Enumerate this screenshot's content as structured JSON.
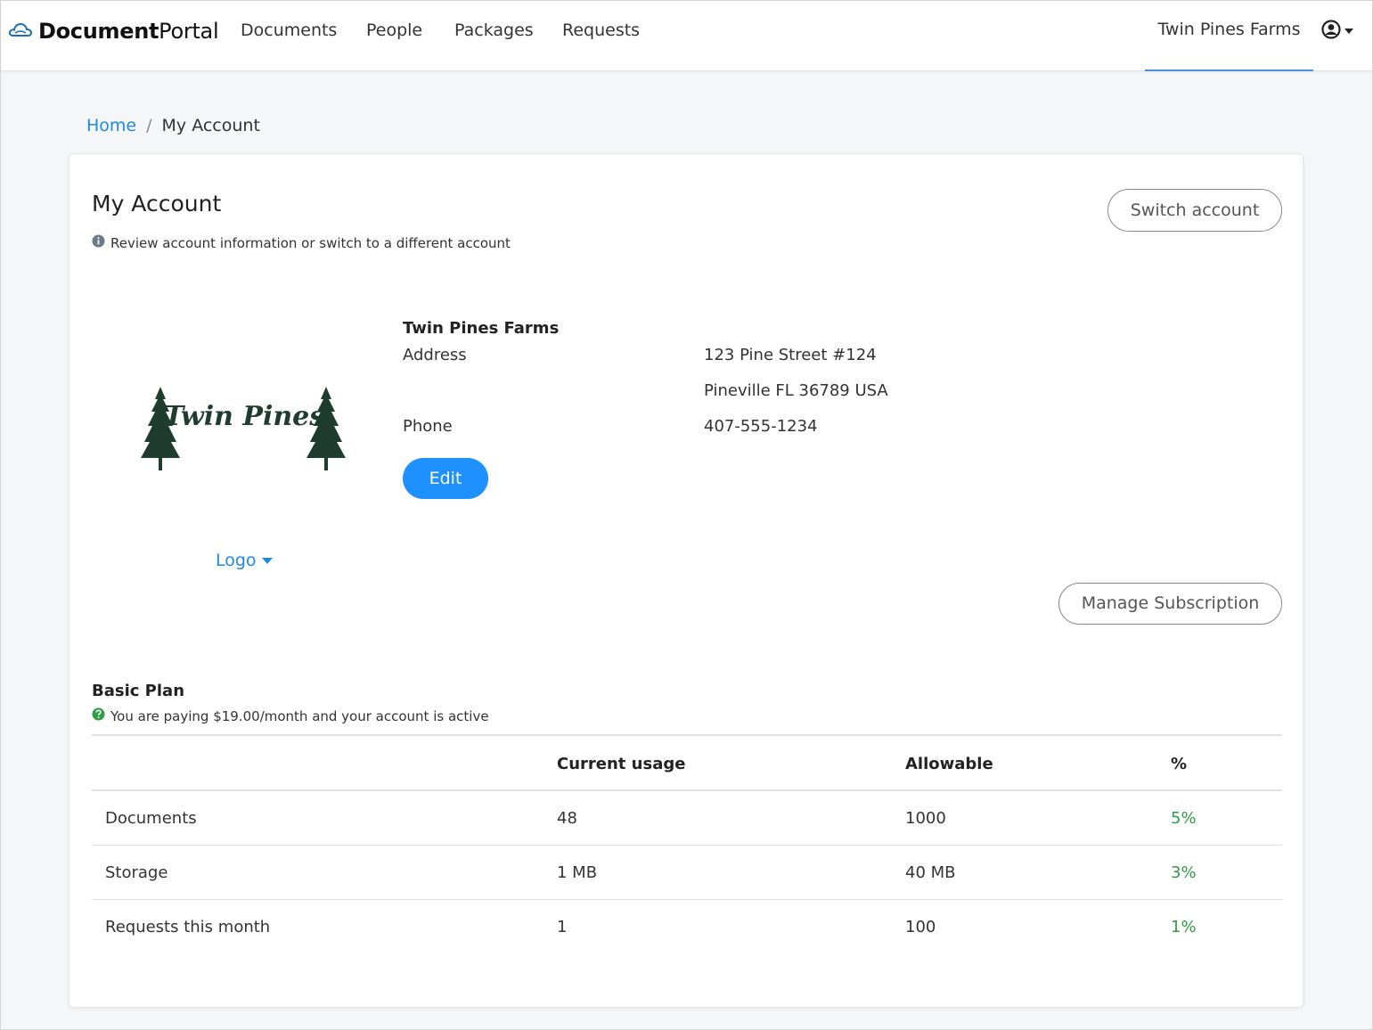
{
  "brand": {
    "bold": "Document",
    "light": "Portal"
  },
  "nav": {
    "items": [
      "Documents",
      "People",
      "Packages",
      "Requests"
    ],
    "account": "Twin Pines Farms"
  },
  "breadcrumb": {
    "home": "Home",
    "separator": "/",
    "current": "My Account"
  },
  "page": {
    "title": "My Account",
    "subtitle": "Review account information or switch to a different account",
    "switch_label": "Switch account",
    "manage_label": "Manage Subscription"
  },
  "logo": {
    "text": "Twin Pines",
    "menu_label": "Logo"
  },
  "company": {
    "name": "Twin Pines Farms",
    "address_label": "Address",
    "address_line1": "123 Pine Street #124",
    "address_line2": "Pineville FL 36789 USA",
    "phone_label": "Phone",
    "phone": "407-555-1234",
    "edit_label": "Edit"
  },
  "plan": {
    "name": "Basic Plan",
    "status": "You are paying $19.00/month and your account is active",
    "headers": [
      "",
      "Current usage",
      "Allowable",
      "%"
    ],
    "rows": [
      {
        "name": "Documents",
        "current": "48",
        "allowable": "1000",
        "percent": "5%"
      },
      {
        "name": "Storage",
        "current": "1 MB",
        "allowable": "40 MB",
        "percent": "3%"
      },
      {
        "name": "Requests this month",
        "current": "1",
        "allowable": "100",
        "percent": "1%"
      }
    ]
  },
  "colors": {
    "primary": "#1e90ff",
    "link": "#1e88e5",
    "success": "#2e9e44"
  },
  "icons": [
    "cloud-icon",
    "user-circle-icon",
    "caret-down-icon",
    "info-icon",
    "question-circle-icon"
  ]
}
